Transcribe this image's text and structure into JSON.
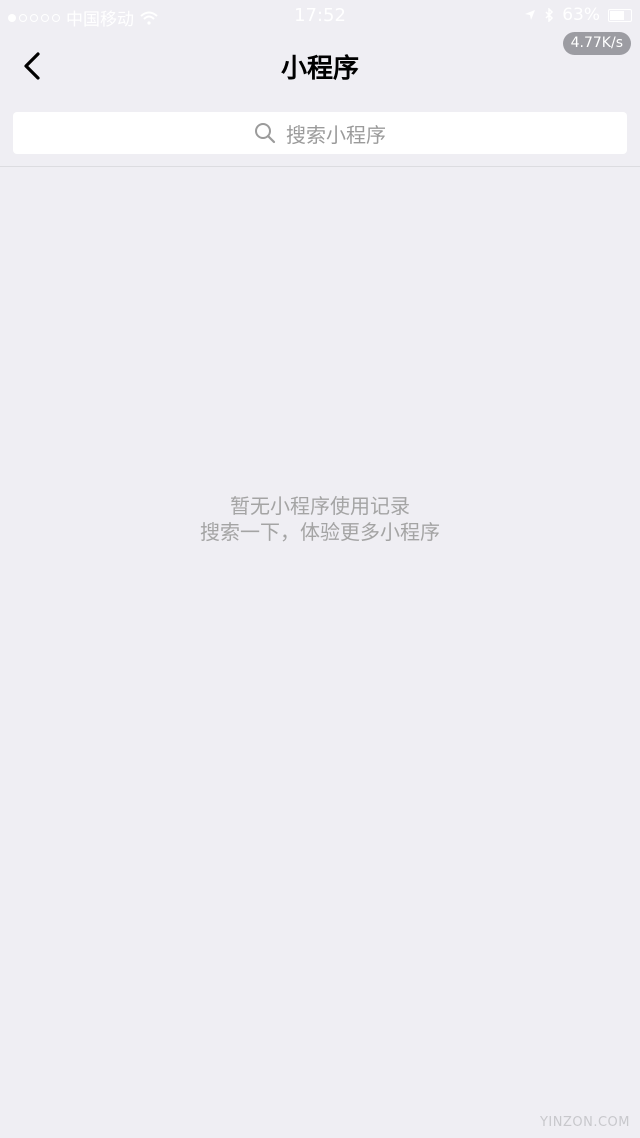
{
  "status_bar": {
    "carrier": "中国移动",
    "time": "17:52",
    "battery": "63%",
    "icons": [
      "signal-dots-icon",
      "wifi-icon",
      "location-arrow-icon",
      "bluetooth-icon",
      "battery-icon"
    ]
  },
  "speed_badge": "4.77K/s",
  "nav": {
    "title": "小程序",
    "back_icon": "chevron-left-icon"
  },
  "search": {
    "placeholder": "搜索小程序",
    "icon": "search-icon"
  },
  "empty_state": {
    "line1": "暂无小程序使用记录",
    "line2": "搜索一下，体验更多小程序"
  },
  "watermark": "YINZON.COM",
  "colors": {
    "background": "#efeef3",
    "search_bg": "#ffffff",
    "placeholder": "#9b9b9b",
    "empty_text": "#a4a4a4"
  }
}
